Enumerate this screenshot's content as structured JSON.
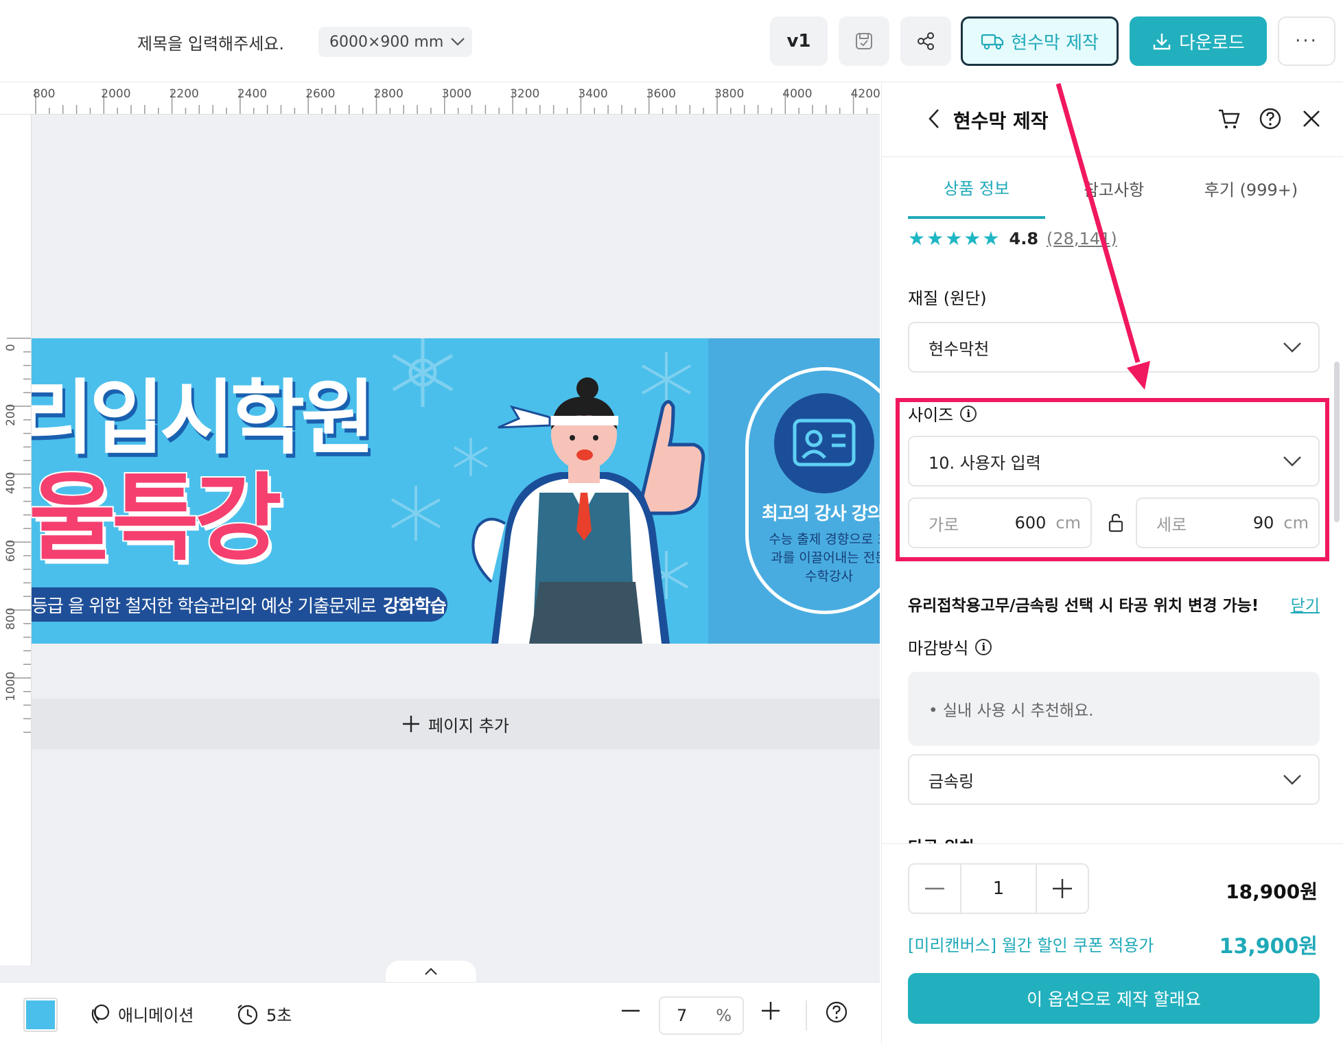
{
  "header": {
    "title_placeholder": "제목을 입력해주세요.",
    "size": "6000×900 mm",
    "version": "v1",
    "make_label": "현수막 제작",
    "download_label": "다운로드",
    "more_label": "···"
  },
  "ruler": {
    "top_labels": [
      "800",
      "2000",
      "2200",
      "2400",
      "2600",
      "2800",
      "3000",
      "3200",
      "3400",
      "3600",
      "3800",
      "4000",
      "4200"
    ],
    "left_labels": [
      "0",
      "200",
      "400",
      "600",
      "800",
      "1000"
    ]
  },
  "banner": {
    "line1": "리입시학원",
    "line2": "울특강",
    "pill_text": "등급 을 위한 철저한 학습관리와 예상 기출문제로",
    "pill_bold": "강화학습",
    "badge_title": "최고의 강사 강의",
    "badge_sub": "수능 출제 경향으로 효과를 이끌어내는 전문 수학강사"
  },
  "canvas": {
    "add_page_label": "페이지 추가",
    "collapse_icon": "chevron-up-icon"
  },
  "bottom": {
    "color": "#4bbfeb",
    "animation_label": "애니메이션",
    "duration_label": "5초",
    "zoom_value": "7",
    "zoom_unit": "%"
  },
  "panel": {
    "title": "현수막 제작",
    "tabs": [
      {
        "label": "상품 정보",
        "active": true
      },
      {
        "label": "참고사항",
        "active": false
      },
      {
        "label": "후기 (999+)",
        "active": false
      }
    ],
    "rating": {
      "stars": "★★★★★",
      "score": "4.8",
      "count": "(28,141)"
    },
    "material": {
      "label": "재질 (원단)",
      "value": "현수막천"
    },
    "size": {
      "label": "사이즈",
      "value": "10. 사용자 입력",
      "width_label": "가로",
      "width_value": "600",
      "height_label": "세로",
      "height_value": "90",
      "unit": "cm"
    },
    "notice": {
      "text": "유리접착용고무/금속링 선택 시 타공 위치 변경 가능!",
      "close_label": "닫기"
    },
    "finish": {
      "label": "마감방식",
      "hint": "•  실내 사용 시 추천해요.",
      "value": "금속링"
    },
    "next_section": "타공 위치",
    "footer": {
      "quantity": "1",
      "price": "18,900원",
      "coupon_label": "[미리캔버스] 월간 할인 쿠폰 적용가",
      "coupon_price": "13,900원",
      "cta_label": "이 옵션으로 제작 할래요"
    }
  },
  "colors": {
    "accent": "#22b0be",
    "highlight": "#f0185e"
  }
}
